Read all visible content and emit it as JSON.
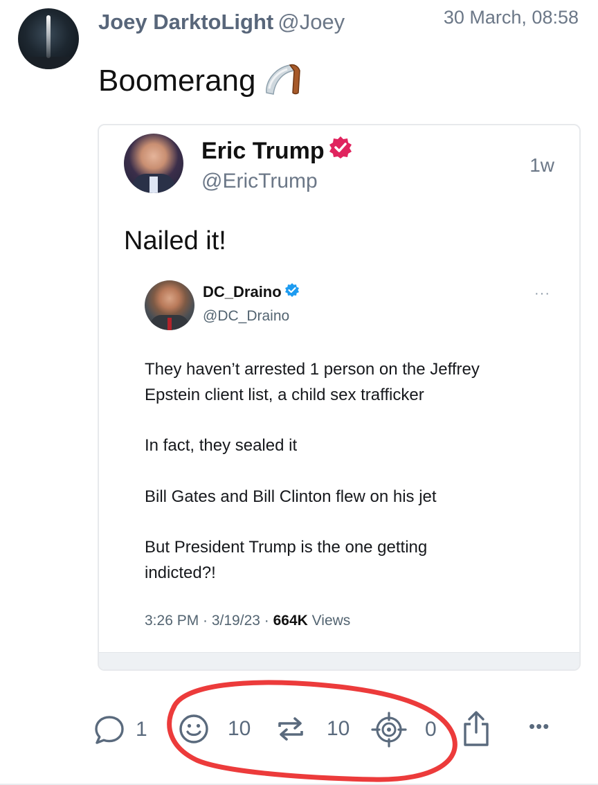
{
  "post": {
    "author_name": "Joey DarktoLight",
    "author_handle": "@Joey",
    "timestamp": "30 March, 08:58",
    "text": "Boomerang",
    "emoji": "boomerang-emoji"
  },
  "embed": {
    "author_name": "Eric Trump",
    "author_handle": "@EricTrump",
    "age": "1w",
    "text": "Nailed it!",
    "quoted": {
      "author_name": "DC_Draino",
      "author_handle": "@DC_Draino",
      "more": "···",
      "lines": [
        "They haven’t arrested 1 person on the Jeffrey",
        "Epstein client list, a child sex trafficker",
        "In fact, they sealed it",
        "Bill Gates and Bill Clinton flew on his jet",
        "But President Trump is the one getting",
        "indicted?!"
      ],
      "meta_time": "3:26 PM · 3/19/23 · ",
      "views_count": "664K",
      "views_label": " Views"
    }
  },
  "actions": {
    "reply_count": "1",
    "reaction_count": "10",
    "repost_count": "10",
    "quote_count": "0",
    "more": "•••"
  },
  "colors": {
    "accent_gray": "#5a6a7d",
    "verified_pink": "#e0245e",
    "verified_blue": "#1d9bf0",
    "annotation_red": "#ec3b3b"
  }
}
